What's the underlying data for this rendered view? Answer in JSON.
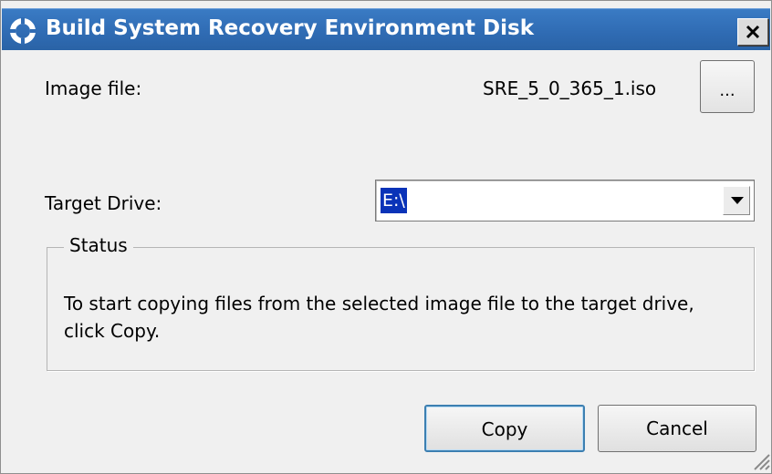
{
  "window": {
    "title": "Build System Recovery Environment Disk",
    "icon": "app-ring-icon",
    "close_label": "X"
  },
  "image_file": {
    "label": "Image file:",
    "value": "SRE_5_0_365_1.iso",
    "browse_label": "..."
  },
  "target_drive": {
    "label": "Target Drive:",
    "selected": "E:\\"
  },
  "status": {
    "legend": "Status",
    "message": "To start copying files from the selected image file to the target drive, click Copy."
  },
  "buttons": {
    "copy": "Copy",
    "cancel": "Cancel"
  },
  "colors": {
    "title_bar": "#2f6bb3",
    "selection": "#0a33b8",
    "default_button_border": "#3c7fb1"
  }
}
